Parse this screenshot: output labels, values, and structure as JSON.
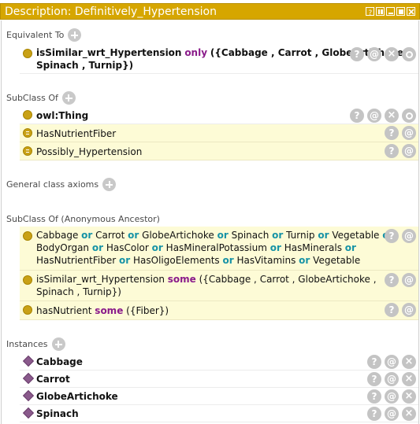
{
  "window": {
    "title": "Description: Definitively_Hypertension"
  },
  "sections": {
    "equivalent_to": {
      "label": "Equivalent To"
    },
    "subclass_of": {
      "label": "SubClass Of"
    },
    "general_axioms": {
      "label": "General class axioms"
    },
    "anonymous_ancestor": {
      "label": "SubClass Of (Anonymous Ancestor)"
    },
    "instances": {
      "label": "Instances"
    }
  },
  "equivalent": {
    "line1_prop": "isSimilar_wrt_Hypertension",
    "line1_kw": "only",
    "line1_rest": "({Cabbage , Carrot , GlobeArtichoke ,",
    "line2": "Spinach , Turnip})"
  },
  "subclasses": {
    "thing": "owl:Thing",
    "fiber": "HasNutrientFiber",
    "possibly": "Possibly_Hypertension"
  },
  "ancestor1": {
    "w1": "Cabbage",
    "w2": "Carrot",
    "w3": "GlobeArtichoke",
    "w4": "Spinach",
    "w5": "Turnip",
    "w6": "Vegetable",
    "w7": "BodyOrgan",
    "w8": "HasColor",
    "w9": "HasMineralPotassium",
    "w10": "HasMinerals",
    "w11": "HasNutrientFiber",
    "w12": "HasOligoElements",
    "w13": "HasVitamins",
    "w14": "Vegetable",
    "or": "or"
  },
  "ancestor2": {
    "prop": "isSimilar_wrt_Hypertension",
    "kw": "some",
    "rest": "({Cabbage , Carrot , GlobeArtichoke ,",
    "line2": "Spinach , Turnip})"
  },
  "ancestor3": {
    "prop": "hasNutrient",
    "kw": "some",
    "rest": "({Fiber})"
  },
  "instances": [
    "Cabbage",
    "Carrot",
    "GlobeArtichoke",
    "Spinach"
  ],
  "icons": {
    "help": "?",
    "annotate": "@",
    "delete": "×"
  },
  "colors": {
    "titlebar": "#d6a600",
    "highlight_row": "#fdfbd6",
    "keyword_purple": "#8a1b8a",
    "keyword_teal": "#1793a6",
    "class_dot": "#c9a116",
    "individual_diamond": "#8a5a8c"
  }
}
